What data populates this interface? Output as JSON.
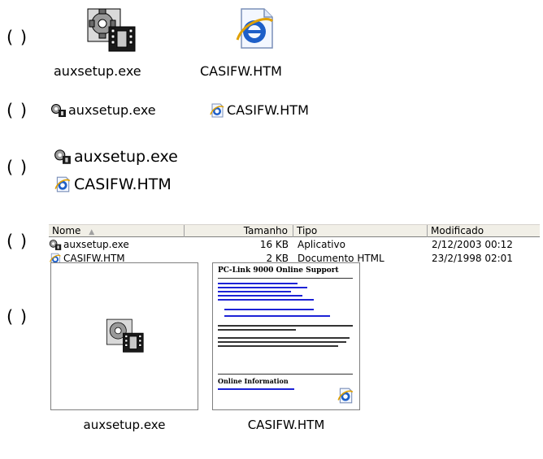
{
  "options": {
    "marker": "( )",
    "thumbnails_marker": "( )"
  },
  "files": [
    {
      "name": "auxsetup.exe",
      "size": "16 KB",
      "type": "Aplicativo",
      "modified": "2/12/2003 00:12",
      "icon": "application-gear-icon"
    },
    {
      "name": "CASIFW.HTM",
      "size": "2 KB",
      "type": "Documento HTML",
      "modified": "23/2/1998 02:01",
      "icon": "internet-explorer-html-icon"
    }
  ],
  "details_header": {
    "name": "Nome",
    "sort_indicator": "▲",
    "size": "Tamanho",
    "type": "Tipo",
    "modified": "Modificado"
  },
  "thumbnail_preview": {
    "title": "PC-Link 9000 Online Support",
    "section": "Online Information"
  },
  "colors": {
    "header_bg": "#f1efe7",
    "ie_blue": "#1e5fc8",
    "link_blue": "#1c22d6"
  }
}
